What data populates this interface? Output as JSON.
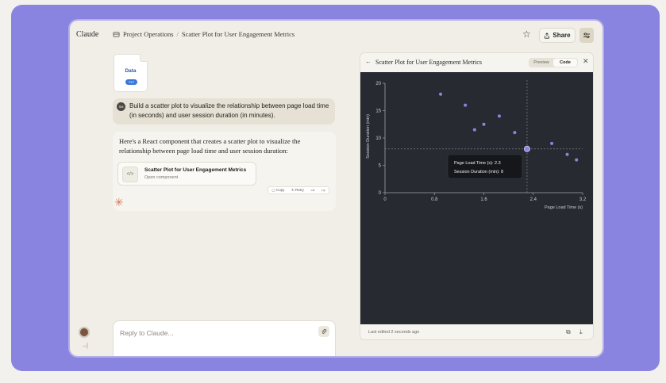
{
  "app": {
    "name": "Claude"
  },
  "breadcrumb": {
    "project": "Project Operations",
    "separator": "/",
    "chat": "Scatter Plot for User Engagement Metrics"
  },
  "header": {
    "share_label": "Share"
  },
  "file": {
    "name": "Data",
    "type": "TXT"
  },
  "user_message": {
    "initials": "SM",
    "text": "Build a scatter plot to visualize the relationship between page load time (in seconds) and user session duration (in minutes)."
  },
  "assistant": {
    "text": "Here's a React component that creates a scatter plot to visualize the relationship between page load time and user session duration:",
    "artifact_title": "Scatter Plot for User Engagement Metrics",
    "artifact_subtitle": "Open component",
    "actions": {
      "copy": "Copy",
      "retry": "Retry"
    }
  },
  "composer": {
    "placeholder": "Reply to Claude..."
  },
  "panel": {
    "title": "Scatter Plot for User Engagement Metrics",
    "tab_preview": "Preview",
    "tab_code": "Code",
    "footer": "Last edited 2 seconds ago"
  },
  "tooltip": {
    "line1": "Page Load Time (s): 2.3",
    "line2": "Session Duration (min): 8"
  },
  "colors": {
    "accent": "#8b85e0",
    "background": "#8a84e1",
    "point": "#8b85e0",
    "plot_bg": "#272a30"
  },
  "chart_data": {
    "type": "scatter",
    "xlabel": "Page Load Time (s)",
    "ylabel": "Session Duration (min)",
    "xlim": [
      0,
      3.2
    ],
    "ylim": [
      0,
      20
    ],
    "xticks": [
      "0",
      "0.8",
      "1.6",
      "2.4",
      "3.2"
    ],
    "yticks": [
      "0",
      "5",
      "10",
      "15",
      "20"
    ],
    "grid": false,
    "points": [
      {
        "x": 0.9,
        "y": 18
      },
      {
        "x": 1.3,
        "y": 16
      },
      {
        "x": 1.45,
        "y": 11.5
      },
      {
        "x": 1.6,
        "y": 12.5
      },
      {
        "x": 1.85,
        "y": 14
      },
      {
        "x": 2.1,
        "y": 11
      },
      {
        "x": 2.3,
        "y": 8
      },
      {
        "x": 2.7,
        "y": 9
      },
      {
        "x": 2.95,
        "y": 7
      },
      {
        "x": 3.1,
        "y": 6
      }
    ],
    "highlight": {
      "x": 2.3,
      "y": 8
    }
  }
}
